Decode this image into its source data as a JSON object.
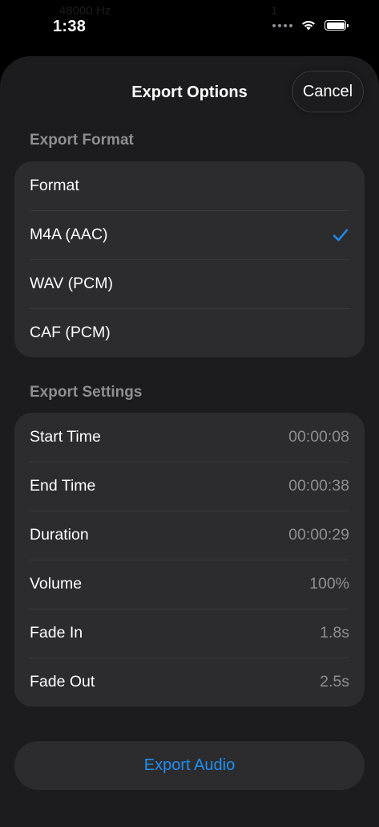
{
  "status_bar": {
    "time": "1:38",
    "ghost_text": "48000 Hz",
    "ghost_number": "1"
  },
  "sheet": {
    "title": "Export Options",
    "cancel_label": "Cancel"
  },
  "export_format": {
    "header": "Export Format",
    "rows": [
      {
        "label": "Format",
        "selected": false
      },
      {
        "label": "M4A (AAC)",
        "selected": true
      },
      {
        "label": "WAV (PCM)",
        "selected": false
      },
      {
        "label": "CAF (PCM)",
        "selected": false
      }
    ]
  },
  "export_settings": {
    "header": "Export Settings",
    "rows": [
      {
        "label": "Start Time",
        "value": "00:00:08"
      },
      {
        "label": "End Time",
        "value": "00:00:38"
      },
      {
        "label": "Duration",
        "value": "00:00:29"
      },
      {
        "label": "Volume",
        "value": "100%"
      },
      {
        "label": "Fade In",
        "value": "1.8s"
      },
      {
        "label": "Fade Out",
        "value": "2.5s"
      }
    ]
  },
  "footer": {
    "export_label": "Export Audio"
  },
  "colors": {
    "background": "#000000",
    "sheet": "#1c1c1e",
    "group": "#2c2c2e",
    "accent": "#1e8ff5",
    "secondary_text": "#8e8e93"
  },
  "icons": {
    "check": "checkmark-icon",
    "wifi": "wifi-icon",
    "battery": "battery-icon",
    "signal": "signal-dots-icon"
  }
}
